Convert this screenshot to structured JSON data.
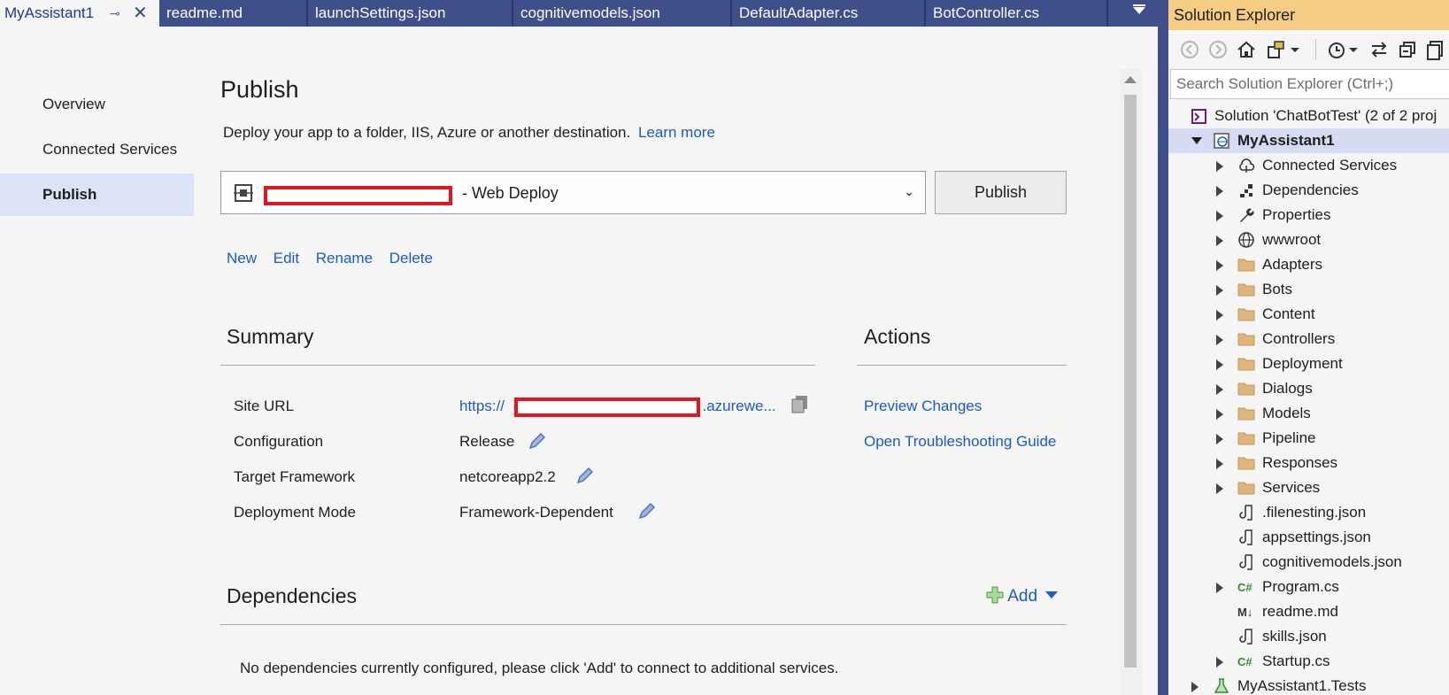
{
  "tabs": [
    {
      "label": "MyAssistant1",
      "active": true
    },
    {
      "label": "readme.md"
    },
    {
      "label": "launchSettings.json"
    },
    {
      "label": "cognitivemodels.json"
    },
    {
      "label": "DefaultAdapter.cs"
    },
    {
      "label": "BotController.cs"
    }
  ],
  "tab_pin_glyph": "⊸",
  "tab_close_glyph": "✕",
  "left_nav": {
    "items": [
      {
        "label": "Overview"
      },
      {
        "label": "Connected Services"
      },
      {
        "label": "Publish",
        "selected": true
      }
    ]
  },
  "main": {
    "title": "Publish",
    "description": "Deploy your app to a folder, IIS, Azure or another destination.",
    "learn_more": "Learn more",
    "profile": {
      "name_suffix": "- Web Deploy",
      "chevron": "⌄"
    },
    "publish_button": "Publish",
    "profile_actions": {
      "new": "New",
      "edit": "Edit",
      "rename": "Rename",
      "delete": "Delete"
    },
    "summary": {
      "title": "Summary",
      "site_url_label": "Site URL",
      "site_url_prefix": "https://",
      "site_url_suffix": ".azurewe...",
      "configuration_label": "Configuration",
      "configuration_value": "Release",
      "framework_label": "Target Framework",
      "framework_value": "netcoreapp2.2",
      "deployment_label": "Deployment Mode",
      "deployment_value": "Framework-Dependent"
    },
    "actions": {
      "title": "Actions",
      "preview": "Preview Changes",
      "troubleshoot": "Open Troubleshooting Guide"
    },
    "dependencies": {
      "title": "Dependencies",
      "add": "Add",
      "empty": "No dependencies currently configured, please click 'Add' to connect to additional services."
    }
  },
  "solution_explorer": {
    "title": "Solution Explorer",
    "search_placeholder": "Search Solution Explorer (Ctrl+;)",
    "tree": [
      {
        "label": "Solution 'ChatBotTest' (2 of 2 proj",
        "icon": "solution-icon"
      },
      {
        "label": "MyAssistant1",
        "icon": "web-project-icon",
        "bold": true,
        "selected": true
      },
      {
        "label": "Connected Services",
        "icon": "cloud-icon"
      },
      {
        "label": "Dependencies",
        "icon": "dependencies-icon"
      },
      {
        "label": "Properties",
        "icon": "wrench-icon"
      },
      {
        "label": "wwwroot",
        "icon": "globe-icon"
      },
      {
        "label": "Adapters",
        "icon": "folder-icon"
      },
      {
        "label": "Bots",
        "icon": "folder-icon"
      },
      {
        "label": "Content",
        "icon": "folder-icon"
      },
      {
        "label": "Controllers",
        "icon": "folder-icon"
      },
      {
        "label": "Deployment",
        "icon": "folder-icon"
      },
      {
        "label": "Dialogs",
        "icon": "folder-icon"
      },
      {
        "label": "Models",
        "icon": "folder-icon"
      },
      {
        "label": "Pipeline",
        "icon": "folder-icon"
      },
      {
        "label": "Responses",
        "icon": "folder-icon"
      },
      {
        "label": "Services",
        "icon": "folder-icon"
      },
      {
        "label": ".filenesting.json",
        "icon": "json-icon"
      },
      {
        "label": "appsettings.json",
        "icon": "json-icon"
      },
      {
        "label": "cognitivemodels.json",
        "icon": "json-icon"
      },
      {
        "label": "Program.cs",
        "icon": "csharp-icon"
      },
      {
        "label": "readme.md",
        "icon": "markdown-icon"
      },
      {
        "label": "skills.json",
        "icon": "json-icon"
      },
      {
        "label": "Startup.cs",
        "icon": "csharp-icon"
      },
      {
        "label": "MyAssistant1.Tests",
        "icon": "test-project-icon"
      }
    ],
    "csharp_glyph": "C#",
    "markdown_glyph": "M↓"
  },
  "colors": {
    "accent": "#3f4f8a",
    "link": "#1a5cbf",
    "redaction": "#e3161d",
    "se_title_bg": "#f5cc84"
  }
}
